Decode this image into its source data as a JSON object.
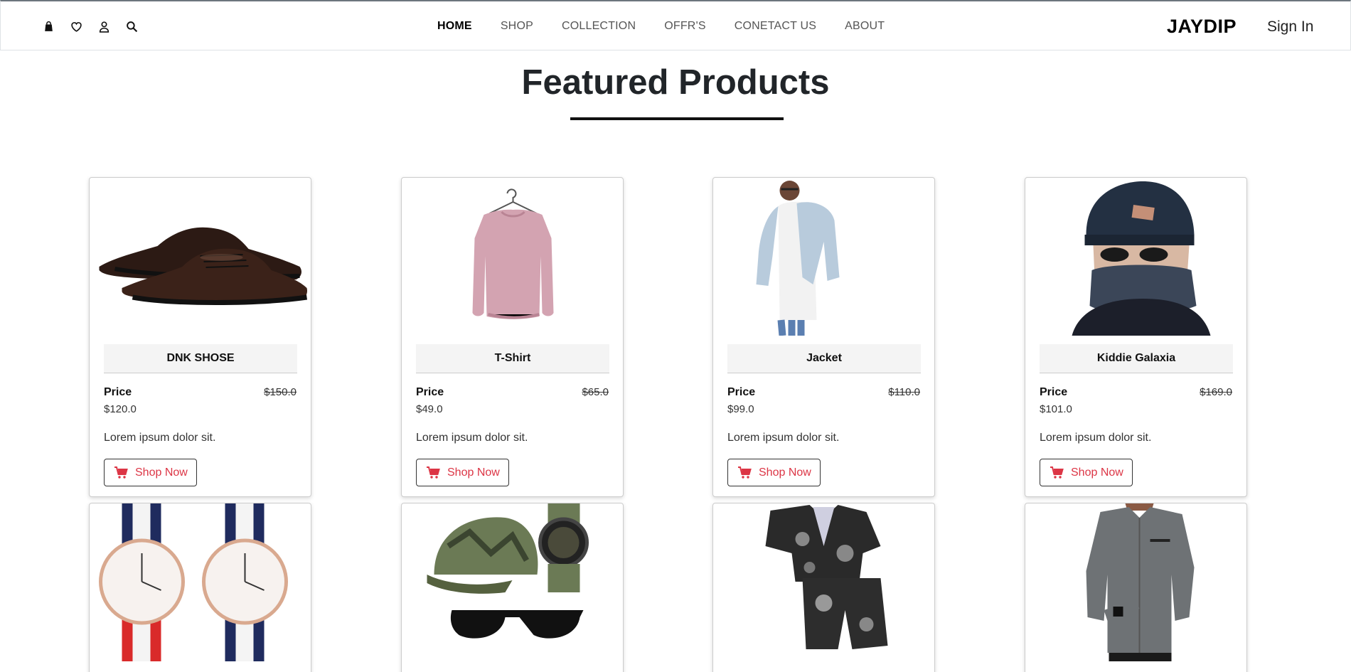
{
  "nav": {
    "icons": [
      "shopping-bag-icon",
      "heart-icon",
      "user-icon",
      "search-icon"
    ],
    "links": [
      "HOME",
      "SHOP",
      "COLLECTION",
      "OFFR'S",
      "CONETACT US",
      "ABOUT"
    ],
    "active": "HOME",
    "brand": "JAYDIP",
    "sign_in": "Sign In"
  },
  "section": {
    "title": "Featured Products"
  },
  "colors": {
    "accent": "#dc3545",
    "text": "#212529",
    "border": "#cccccc"
  },
  "products": [
    {
      "name": "DNK SHOSE",
      "price_label": "Price",
      "price": "$120.0",
      "old_price": "$150.0",
      "description": "Lorem ipsum dolor sit.",
      "button": "Shop Now",
      "image": "dress-shoes-image"
    },
    {
      "name": "T-Shirt",
      "price_label": "Price",
      "price": "$49.0",
      "old_price": "$65.0",
      "description": "Lorem ipsum dolor sit.",
      "button": "Shop Now",
      "image": "pink-sweatshirt-image"
    },
    {
      "name": "Jacket",
      "price_label": "Price",
      "price": "$99.0",
      "old_price": "$110.0",
      "description": "Lorem ipsum dolor sit.",
      "button": "Shop Now",
      "image": "denim-jacket-model-image"
    },
    {
      "name": "Kiddie Galaxia",
      "price_label": "Price",
      "price": "$101.0",
      "old_price": "$169.0",
      "description": "Lorem ipsum dolor sit.",
      "button": "Shop Now",
      "image": "beanie-scarf-model-image"
    }
  ],
  "products_row2": [
    {
      "image": "nato-watches-image"
    },
    {
      "image": "camo-cap-watch-sunglasses-image"
    },
    {
      "image": "printed-shirt-shorts-image"
    },
    {
      "image": "grey-shirt-model-image"
    }
  ]
}
